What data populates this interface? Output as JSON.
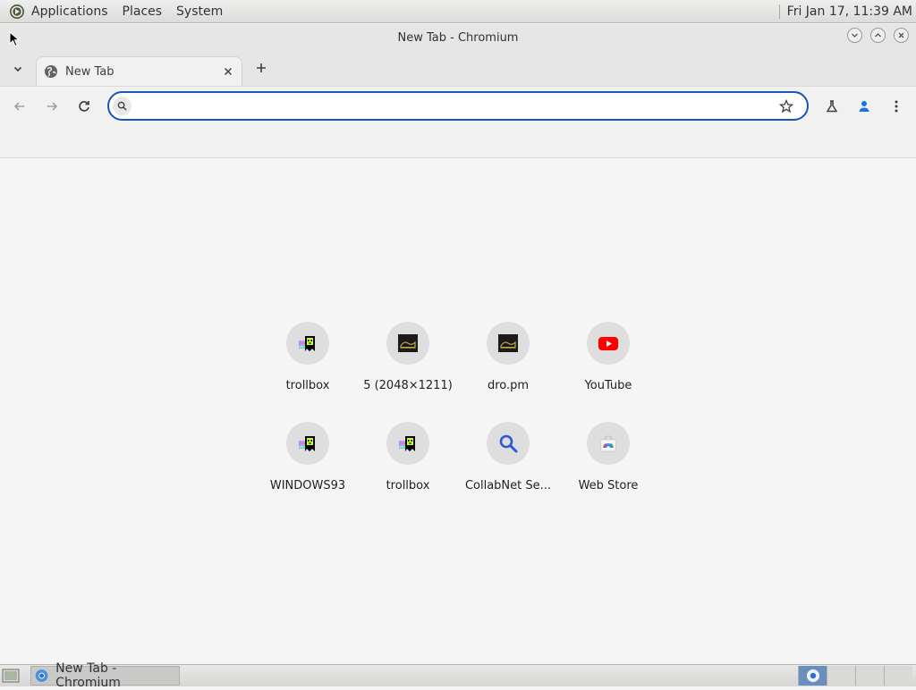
{
  "panel": {
    "menus": [
      "Applications",
      "Places",
      "System"
    ],
    "clock": "Fri Jan 17, 11:39 AM"
  },
  "window": {
    "title": "New Tab - Chromium"
  },
  "tabs": [
    {
      "label": "New Tab",
      "favicon": "globe-icon",
      "active": true
    }
  ],
  "omnibox": {
    "value": "",
    "placeholder": ""
  },
  "shortcuts": [
    {
      "label": "trollbox",
      "icon": "trollbox-icon"
    },
    {
      "label": "5 (2048×1211)",
      "icon": "image-thumb-icon"
    },
    {
      "label": "dro.pm",
      "icon": "image-thumb-icon"
    },
    {
      "label": "YouTube",
      "icon": "youtube-icon"
    },
    {
      "label": "WINDOWS93",
      "icon": "trollbox-icon"
    },
    {
      "label": "trollbox",
      "icon": "trollbox-icon"
    },
    {
      "label": "CollabNet Se...",
      "icon": "search-icon"
    },
    {
      "label": "Web Store",
      "icon": "webstore-icon"
    }
  ],
  "taskbar": {
    "items": [
      {
        "label": "New Tab - Chromium",
        "icon": "chromium-icon"
      }
    ],
    "workspaces": 4,
    "active_workspace": 1
  },
  "colors": {
    "accent": "#1a56b8",
    "profile": "#1a73e8",
    "youtube": "#ff0000"
  }
}
